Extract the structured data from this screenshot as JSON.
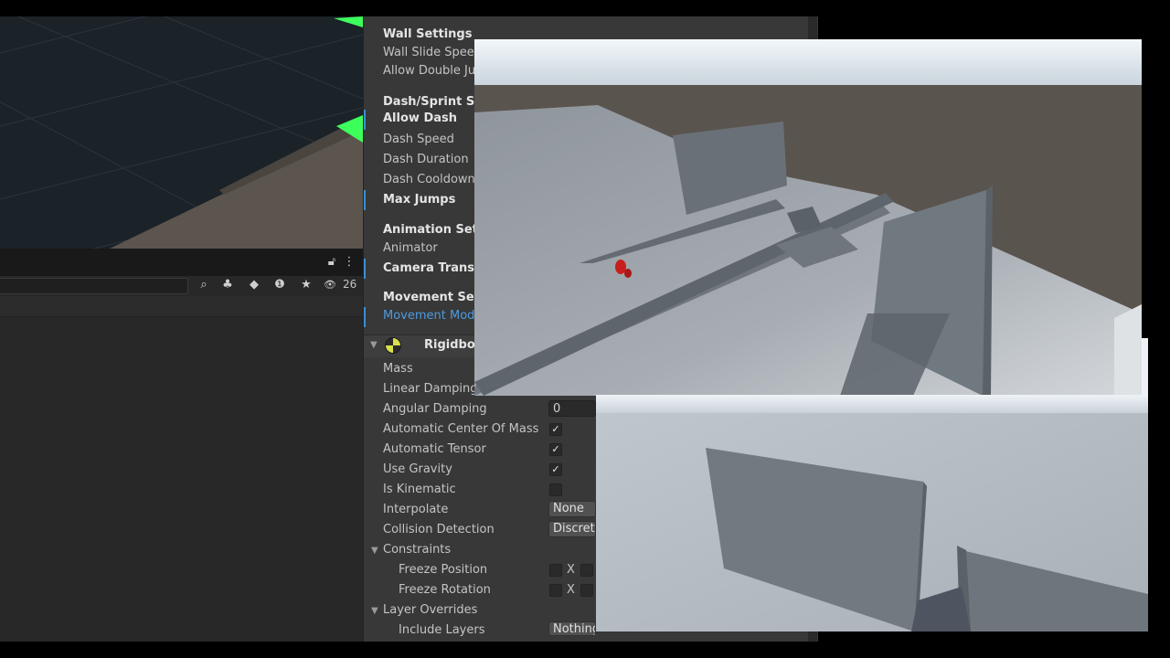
{
  "hierarchy": {
    "count": "26"
  },
  "inspector": {
    "wall_settings": {
      "header": "Wall Settings",
      "rows": [
        "Wall Slide Speed",
        "Allow Double Ju"
      ]
    },
    "dash_settings": {
      "header": "Dash/Sprint Set",
      "allow_dash": "Allow Dash",
      "rows": [
        "Dash Speed",
        "Dash Duration",
        "Dash Cooldown"
      ],
      "max_jumps": "Max Jumps"
    },
    "animation_settings": {
      "header": "Animation Setti",
      "animator": "Animator",
      "camera": "Camera Transfo"
    },
    "movement_settings": {
      "header": "Movement Setti",
      "movement_mode": "Movement Mod"
    },
    "rigidbody": {
      "title": "Rigidboc",
      "mass": "Mass",
      "linear_damping": "Linear Damping",
      "angular_damping": "Angular Damping",
      "angular_damping_value": "0",
      "auto_center": "Automatic Center Of Mass",
      "auto_tensor": "Automatic Tensor",
      "use_gravity": "Use Gravity",
      "is_kinematic": "Is Kinematic",
      "interpolate": "Interpolate",
      "interpolate_value": "None",
      "collision_detection": "Collision Detection",
      "collision_value": "Discrete",
      "constraints": "Constraints",
      "freeze_position": "Freeze Position",
      "freeze_rotation": "Freeze Rotation",
      "axis_x": "X",
      "layer_overrides": "Layer Overrides",
      "include_layers": "Include Layers",
      "include_value": "Nothing"
    },
    "checkmark": "✓",
    "fold_arrow": "▼"
  },
  "colors": {
    "accent_blue": "#4c9be0",
    "gizmo_green": "#3dff5c",
    "inspector_bg": "#383838"
  },
  "icons": [
    "lock-icon",
    "menu-icon",
    "search-icon",
    "audio-icon",
    "tag-icon",
    "warning-icon",
    "star-icon",
    "eye-icon",
    "rigidbody-icon"
  ]
}
